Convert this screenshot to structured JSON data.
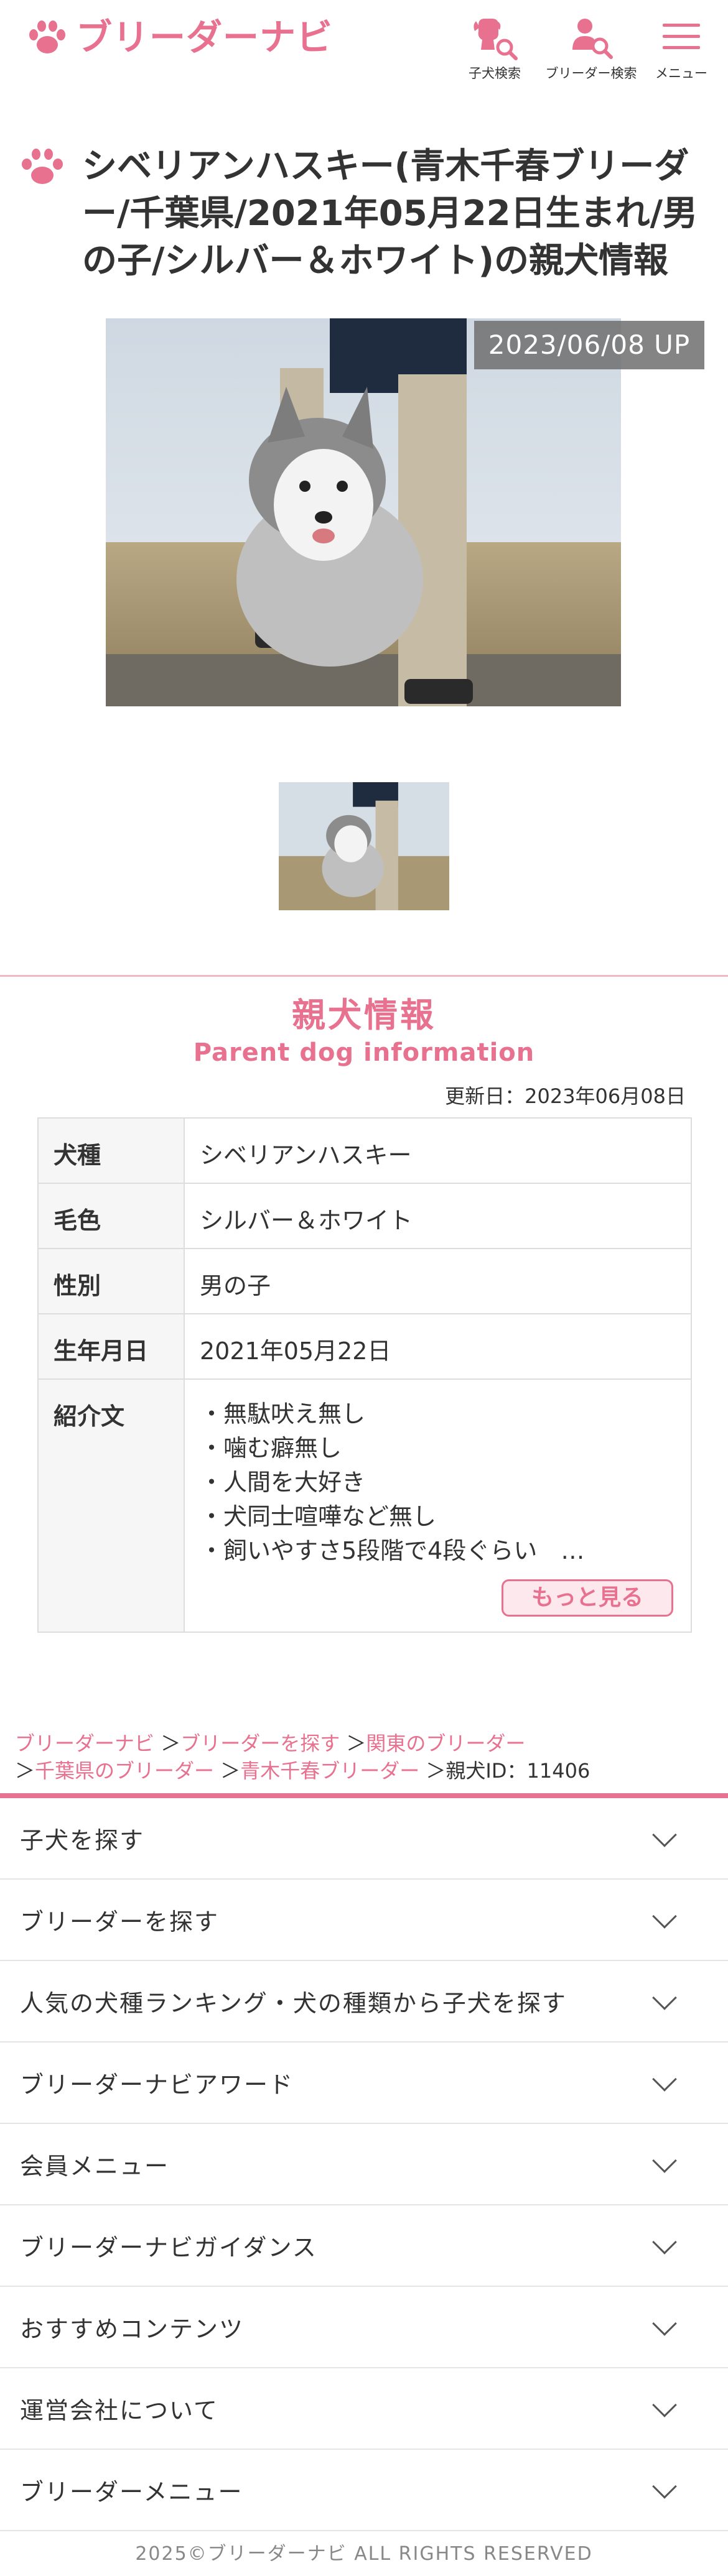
{
  "header": {
    "logo_text": "ブリーダーナビ",
    "nav": [
      {
        "label": "子犬検索",
        "icon": "puppy-search-icon"
      },
      {
        "label": "ブリーダー検索",
        "icon": "breeder-search-icon"
      },
      {
        "label": "メニュー",
        "icon": "hamburger-menu-icon"
      }
    ]
  },
  "page": {
    "title": "シベリアンハスキー(青木千春ブリーダー/千葉県/2021年05月22日生まれ/男の子/シルバー＆ホワイト)の親犬情報",
    "upload_badge": "2023/06/08 UP"
  },
  "section": {
    "title": "親犬情報",
    "subtitle": "Parent dog information",
    "updated": "更新日：2023年06月08日"
  },
  "info": {
    "rows": [
      {
        "label": "犬種",
        "value": "シベリアンハスキー"
      },
      {
        "label": "毛色",
        "value": "シルバー＆ホワイト"
      },
      {
        "label": "性別",
        "value": "男の子"
      },
      {
        "label": "生年月日",
        "value": "2021年05月22日"
      }
    ],
    "intro_label": "紹介文",
    "intro_lines": [
      "・無駄吠え無し",
      "・噛む癖無し",
      "・人間を大好き",
      "・犬同士喧嘩など無し",
      "・飼いやすさ5段階で4段ぐらい　…"
    ],
    "more_label": "もっと見る"
  },
  "breadcrumb": {
    "items": [
      "ブリーダーナビ",
      "ブリーダーを探す",
      "関東のブリーダー",
      "千葉県のブリーダー",
      "青木千春ブリーダー"
    ],
    "current": "親犬ID：11406",
    "sep": "＞"
  },
  "footer_menu": [
    "子犬を探す",
    "ブリーダーを探す",
    "人気の犬種ランキング・犬の種類から子犬を探す",
    "ブリーダーナビアワード",
    "会員メニュー",
    "ブリーダーナビガイダンス",
    "おすすめコンテンツ",
    "運営会社について",
    "ブリーダーメニュー"
  ],
  "copyright": "2025©ブリーダーナビ ALL RIGHTS RESERVED",
  "colors": {
    "accent": "#e8718f",
    "accent_light": "#fde8ee",
    "border": "#dddddd"
  }
}
